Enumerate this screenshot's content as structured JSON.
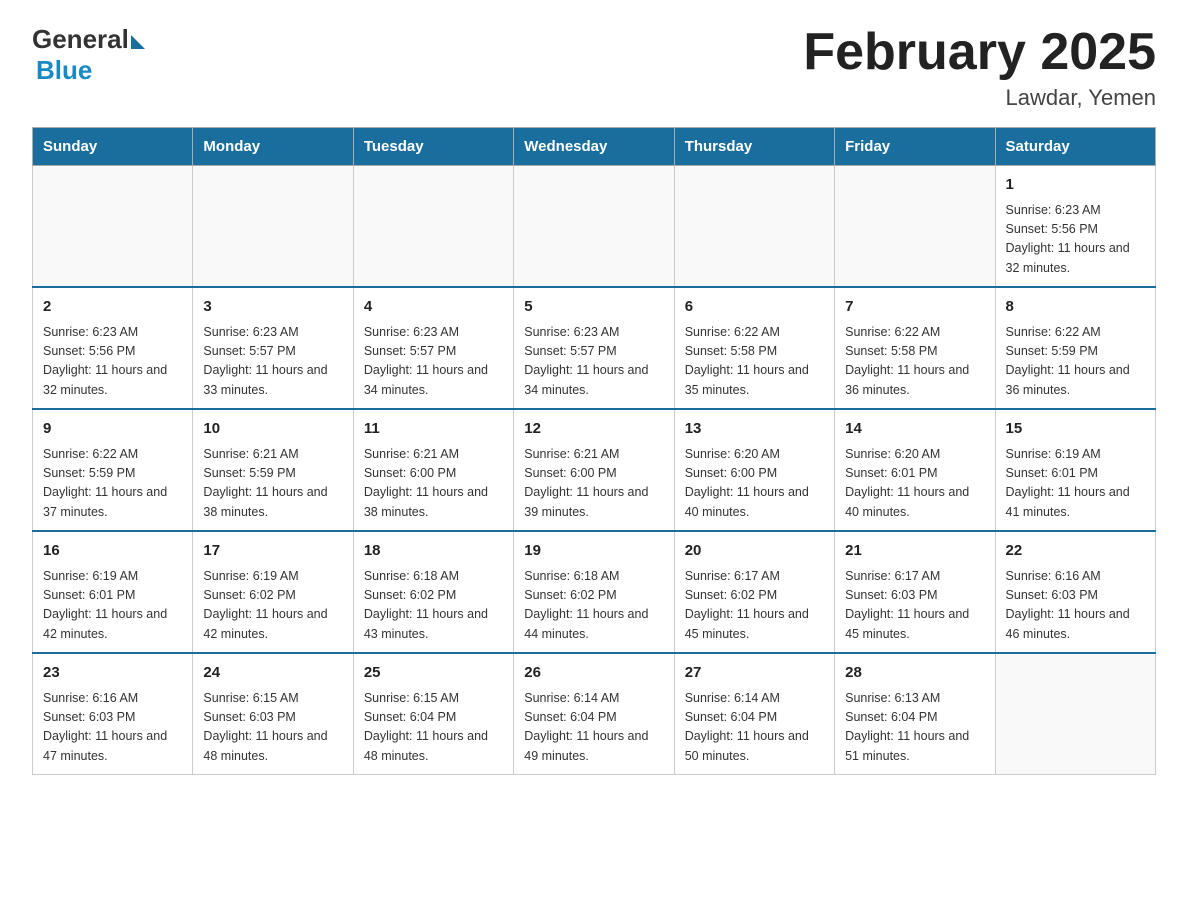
{
  "logo": {
    "general": "General",
    "blue": "Blue"
  },
  "header": {
    "title": "February 2025",
    "location": "Lawdar, Yemen"
  },
  "weekdays": [
    "Sunday",
    "Monday",
    "Tuesday",
    "Wednesday",
    "Thursday",
    "Friday",
    "Saturday"
  ],
  "weeks": [
    [
      {
        "day": "",
        "info": ""
      },
      {
        "day": "",
        "info": ""
      },
      {
        "day": "",
        "info": ""
      },
      {
        "day": "",
        "info": ""
      },
      {
        "day": "",
        "info": ""
      },
      {
        "day": "",
        "info": ""
      },
      {
        "day": "1",
        "info": "Sunrise: 6:23 AM\nSunset: 5:56 PM\nDaylight: 11 hours\nand 32 minutes."
      }
    ],
    [
      {
        "day": "2",
        "info": "Sunrise: 6:23 AM\nSunset: 5:56 PM\nDaylight: 11 hours\nand 32 minutes."
      },
      {
        "day": "3",
        "info": "Sunrise: 6:23 AM\nSunset: 5:57 PM\nDaylight: 11 hours\nand 33 minutes."
      },
      {
        "day": "4",
        "info": "Sunrise: 6:23 AM\nSunset: 5:57 PM\nDaylight: 11 hours\nand 34 minutes."
      },
      {
        "day": "5",
        "info": "Sunrise: 6:23 AM\nSunset: 5:57 PM\nDaylight: 11 hours\nand 34 minutes."
      },
      {
        "day": "6",
        "info": "Sunrise: 6:22 AM\nSunset: 5:58 PM\nDaylight: 11 hours\nand 35 minutes."
      },
      {
        "day": "7",
        "info": "Sunrise: 6:22 AM\nSunset: 5:58 PM\nDaylight: 11 hours\nand 36 minutes."
      },
      {
        "day": "8",
        "info": "Sunrise: 6:22 AM\nSunset: 5:59 PM\nDaylight: 11 hours\nand 36 minutes."
      }
    ],
    [
      {
        "day": "9",
        "info": "Sunrise: 6:22 AM\nSunset: 5:59 PM\nDaylight: 11 hours\nand 37 minutes."
      },
      {
        "day": "10",
        "info": "Sunrise: 6:21 AM\nSunset: 5:59 PM\nDaylight: 11 hours\nand 38 minutes."
      },
      {
        "day": "11",
        "info": "Sunrise: 6:21 AM\nSunset: 6:00 PM\nDaylight: 11 hours\nand 38 minutes."
      },
      {
        "day": "12",
        "info": "Sunrise: 6:21 AM\nSunset: 6:00 PM\nDaylight: 11 hours\nand 39 minutes."
      },
      {
        "day": "13",
        "info": "Sunrise: 6:20 AM\nSunset: 6:00 PM\nDaylight: 11 hours\nand 40 minutes."
      },
      {
        "day": "14",
        "info": "Sunrise: 6:20 AM\nSunset: 6:01 PM\nDaylight: 11 hours\nand 40 minutes."
      },
      {
        "day": "15",
        "info": "Sunrise: 6:19 AM\nSunset: 6:01 PM\nDaylight: 11 hours\nand 41 minutes."
      }
    ],
    [
      {
        "day": "16",
        "info": "Sunrise: 6:19 AM\nSunset: 6:01 PM\nDaylight: 11 hours\nand 42 minutes."
      },
      {
        "day": "17",
        "info": "Sunrise: 6:19 AM\nSunset: 6:02 PM\nDaylight: 11 hours\nand 42 minutes."
      },
      {
        "day": "18",
        "info": "Sunrise: 6:18 AM\nSunset: 6:02 PM\nDaylight: 11 hours\nand 43 minutes."
      },
      {
        "day": "19",
        "info": "Sunrise: 6:18 AM\nSunset: 6:02 PM\nDaylight: 11 hours\nand 44 minutes."
      },
      {
        "day": "20",
        "info": "Sunrise: 6:17 AM\nSunset: 6:02 PM\nDaylight: 11 hours\nand 45 minutes."
      },
      {
        "day": "21",
        "info": "Sunrise: 6:17 AM\nSunset: 6:03 PM\nDaylight: 11 hours\nand 45 minutes."
      },
      {
        "day": "22",
        "info": "Sunrise: 6:16 AM\nSunset: 6:03 PM\nDaylight: 11 hours\nand 46 minutes."
      }
    ],
    [
      {
        "day": "23",
        "info": "Sunrise: 6:16 AM\nSunset: 6:03 PM\nDaylight: 11 hours\nand 47 minutes."
      },
      {
        "day": "24",
        "info": "Sunrise: 6:15 AM\nSunset: 6:03 PM\nDaylight: 11 hours\nand 48 minutes."
      },
      {
        "day": "25",
        "info": "Sunrise: 6:15 AM\nSunset: 6:04 PM\nDaylight: 11 hours\nand 48 minutes."
      },
      {
        "day": "26",
        "info": "Sunrise: 6:14 AM\nSunset: 6:04 PM\nDaylight: 11 hours\nand 49 minutes."
      },
      {
        "day": "27",
        "info": "Sunrise: 6:14 AM\nSunset: 6:04 PM\nDaylight: 11 hours\nand 50 minutes."
      },
      {
        "day": "28",
        "info": "Sunrise: 6:13 AM\nSunset: 6:04 PM\nDaylight: 11 hours\nand 51 minutes."
      },
      {
        "day": "",
        "info": ""
      }
    ]
  ]
}
